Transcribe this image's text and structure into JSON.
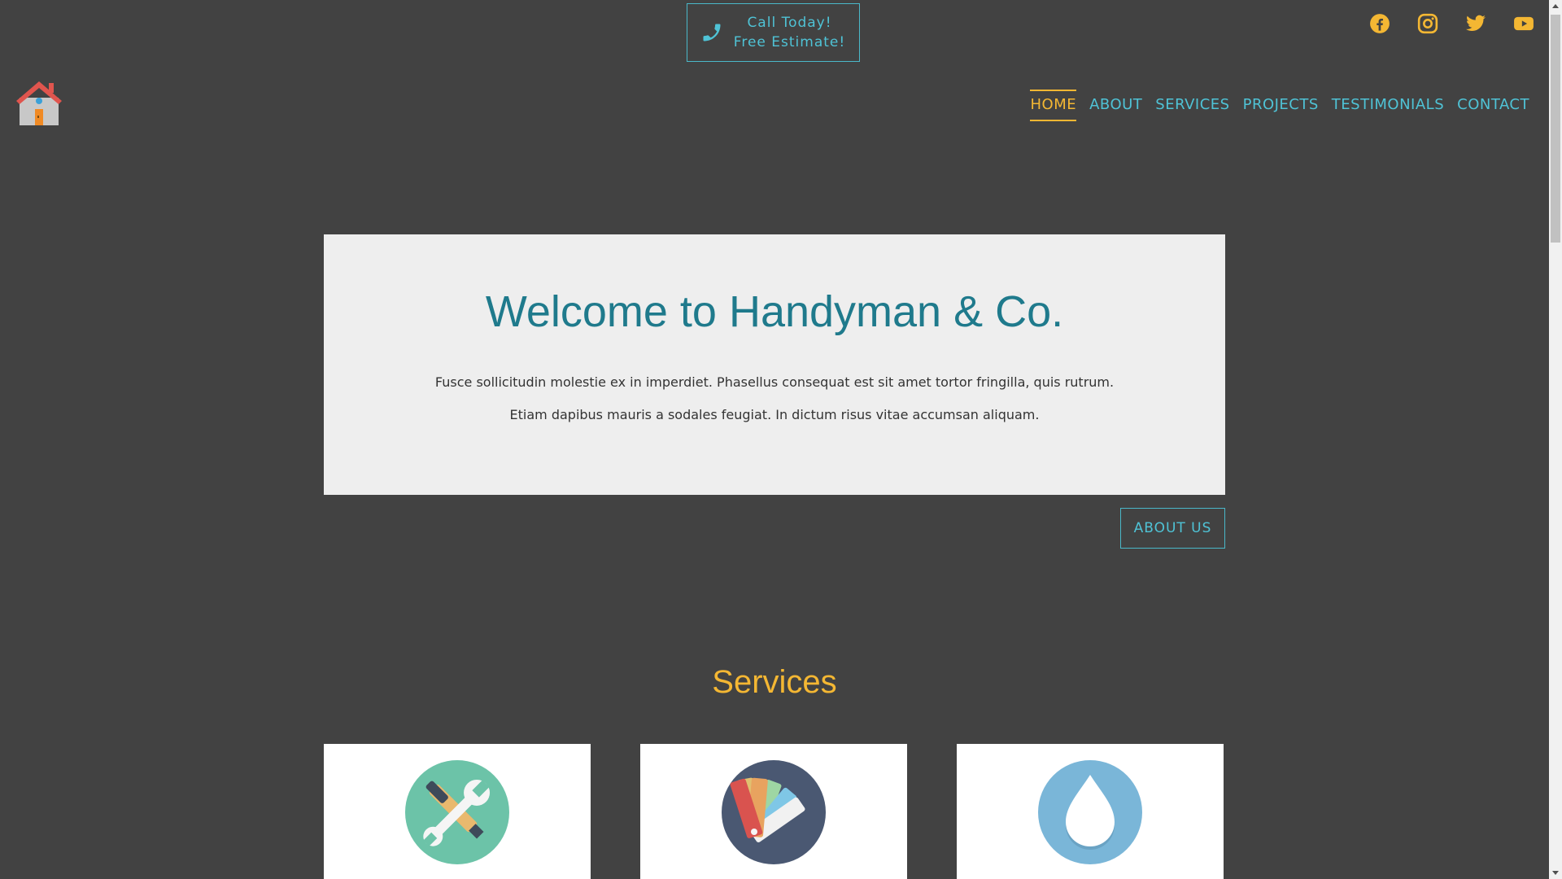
{
  "header": {
    "call_line1": "Call Today!",
    "call_line2": "Free Estimate!"
  },
  "social": [
    "facebook-icon",
    "instagram-icon",
    "twitter-icon",
    "youtube-icon"
  ],
  "nav": {
    "items": [
      {
        "label": "HOME",
        "active": true
      },
      {
        "label": "ABOUT"
      },
      {
        "label": "SERVICES"
      },
      {
        "label": "PROJECTS"
      },
      {
        "label": "TESTIMONIALS"
      },
      {
        "label": "CONTACT"
      }
    ]
  },
  "hero": {
    "title": "Welcome to Handyman & Co.",
    "line1": "Fusce sollicitudin molestie ex in imperdiet. Phasellus consequat est sit amet tortor fringilla, quis rutrum.",
    "line2": "Etiam dapibus mauris a sodales feugiat. In dictum risus vitae accumsan aliquam.",
    "button_label": "ABOUT US"
  },
  "services": {
    "title": "Services",
    "cards": [
      "tools-icon",
      "color-swatch-icon",
      "water-drop-icon"
    ]
  },
  "colors": {
    "background": "#424242",
    "accent_teal": "#4fc3d6",
    "accent_gold": "#f4b733",
    "hero_title": "#1f7a8c"
  }
}
